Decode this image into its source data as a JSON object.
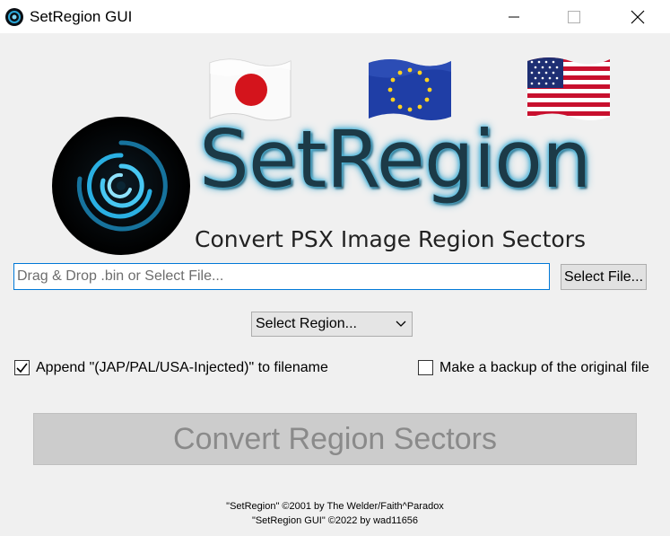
{
  "window": {
    "title": "SetRegion GUI",
    "icons": [
      "app-icon",
      "minimize-icon",
      "maximize-icon",
      "close-icon"
    ]
  },
  "header": {
    "logo_text": "SetRegion",
    "tagline": "Convert PSX Image Region Sectors",
    "flags": [
      "japan-flag",
      "eu-flag",
      "usa-flag"
    ]
  },
  "file": {
    "placeholder": "Drag & Drop .bin or Select File...",
    "select_label": "Select File..."
  },
  "region": {
    "selected": "Select Region..."
  },
  "options": {
    "append_label": "Append \"(JAP/PAL/USA-Injected)\" to filename",
    "append_checked": true,
    "backup_label": "Make a backup of the original file",
    "backup_checked": false
  },
  "convert": {
    "label": "Convert Region Sectors",
    "enabled": false
  },
  "credits": {
    "line1": "\"SetRegion\" ©2001 by The Welder/Faith^Paradox",
    "line2": "\"SetRegion GUI\" ©2022 by wad11656"
  },
  "colors": {
    "accent": "#0078d7",
    "logo_text": "#1c3a47",
    "logo_glow": "#4ab6dc"
  }
}
